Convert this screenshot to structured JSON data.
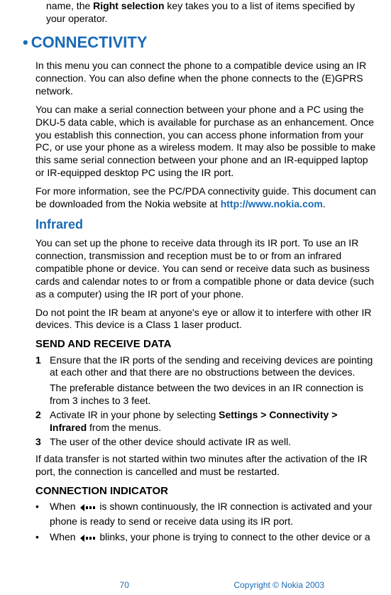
{
  "fragment": {
    "pre": "name, the ",
    "bold": "Right selection",
    "post": " key takes you to a list of items specified by your operator."
  },
  "sections": {
    "connectivity_title": "CONNECTIVITY",
    "p1": "In this menu you can connect the phone to a compatible device using an IR connection. You can also define when the phone connects to the (E)GPRS network.",
    "p2": "You can make a serial connection between your phone and a PC using the DKU-5 data cable, which is available for purchase as an enhancement. Once you establish this connection, you can access phone information from your PC, or use your phone as a wireless modem. It may also be possible to make this same serial connection between your phone and an IR-equipped laptop or IR-equipped desktop PC using the IR port.",
    "p3_pre": "For more information, see the PC/PDA connectivity guide. This document can be downloaded from the Nokia website at ",
    "p3_link": "http://www.nokia.com",
    "p3_post": "."
  },
  "infrared": {
    "title": "Infrared",
    "p1": "You can set up the phone to receive data through its IR port. To use an IR connection, transmission and reception must be to or from an infrared compatible phone or device. You can send or receive data such as business cards and calendar notes to or from a compatible phone or data device (such as a computer) using the IR port of your phone.",
    "p2": "Do not point the IR beam at anyone's eye or allow it to interfere with other IR devices. This device is a Class 1 laser product."
  },
  "send_receive": {
    "title": "SEND AND RECEIVE DATA",
    "steps": [
      {
        "n": "1",
        "text": "Ensure that the IR ports of the sending and receiving devices are pointing at each other and that there are no obstructions between the devices.",
        "sub": "The preferable distance between the two devices in an IR connection is from 3 inches to 3 feet."
      },
      {
        "n": "2",
        "pre": "Activate IR in your phone by selecting ",
        "bold": "Settings > Connectivity > Infrared",
        "post": " from the menus."
      },
      {
        "n": "3",
        "text": "The user of the other device should activate IR as well."
      }
    ],
    "after": "If data transfer is not started within two minutes after the activation of the IR port, the connection is cancelled and must be restarted."
  },
  "indicator": {
    "title": "CONNECTION INDICATOR",
    "bullets": [
      {
        "pre": "When ",
        "post": " is shown continuously, the IR connection is activated and your phone is ready to send or receive data using its IR port."
      },
      {
        "pre": "When ",
        "post": " blinks, your phone is trying to connect to the other device or a"
      }
    ]
  },
  "footer": {
    "page": "70",
    "copyright": "Copyright © Nokia 2003"
  }
}
